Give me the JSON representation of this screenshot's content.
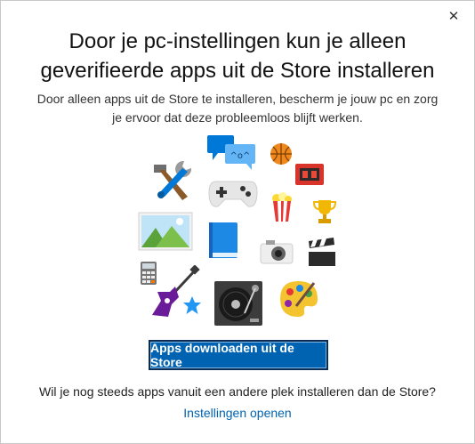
{
  "dialog": {
    "close_glyph": "✕",
    "title_line1": "Door je pc-instellingen kun je alleen",
    "title_line2": "geverifieerde apps uit de Store installeren",
    "subtitle_line1": "Door alleen apps uit de Store te installeren, bescherm je jouw pc en zorg",
    "subtitle_line2": "je ervoor dat deze probleemloos blijft werken.",
    "store_button_label": "Apps downloaden uit de Store",
    "question": "Wil je nog steeds apps vanuit een andere plek installeren dan de Store?",
    "settings_link": "Instellingen openen"
  },
  "colors": {
    "accent": "#0063b1",
    "button_border": "#0a2d56",
    "link": "#0063b1"
  },
  "icons": [
    "tools-icon",
    "chat-bubbles-icon",
    "basketball-icon",
    "ticket-icon",
    "gamepad-icon",
    "popcorn-icon",
    "trophy-icon",
    "landscape-photo-icon",
    "book-icon",
    "camera-icon",
    "clapperboard-icon",
    "calculator-icon",
    "guitar-icon",
    "star-icon",
    "turntable-icon",
    "paint-palette-icon"
  ]
}
